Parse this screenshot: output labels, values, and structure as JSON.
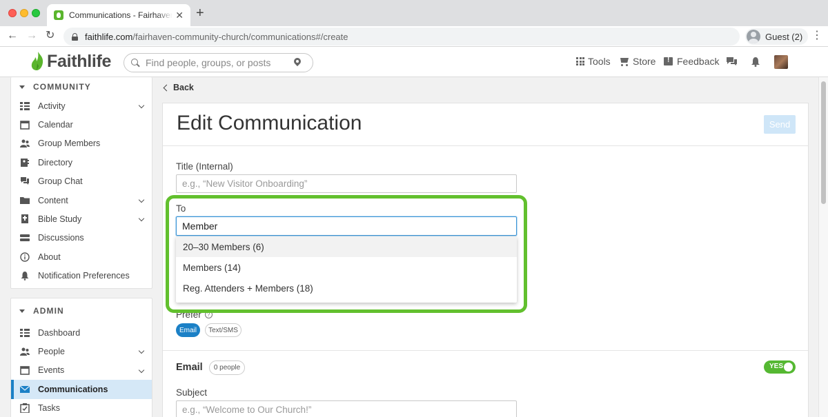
{
  "browser": {
    "tab_title": "Communications - Fairhaven C",
    "url_host": "faithlife.com",
    "url_path": "/fairhaven-community-church/communications#/create",
    "profile_label": "Guest (2)"
  },
  "header": {
    "logo_text": "Faithlife",
    "search_placeholder": "Find people, groups, or posts",
    "menu": {
      "tools": "Tools",
      "store": "Store",
      "feedback": "Feedback"
    }
  },
  "sidebar": {
    "community_title": "COMMUNITY",
    "community_items": [
      {
        "label": "Activity",
        "icon": "activity-icon",
        "expandable": true
      },
      {
        "label": "Calendar",
        "icon": "calendar-icon",
        "expandable": false
      },
      {
        "label": "Group Members",
        "icon": "group-members-icon",
        "expandable": false
      },
      {
        "label": "Directory",
        "icon": "directory-icon",
        "expandable": false
      },
      {
        "label": "Group Chat",
        "icon": "chat-icon",
        "expandable": false
      },
      {
        "label": "Content",
        "icon": "folder-icon",
        "expandable": true
      },
      {
        "label": "Bible Study",
        "icon": "bible-icon",
        "expandable": true
      },
      {
        "label": "Discussions",
        "icon": "discussions-icon",
        "expandable": false
      },
      {
        "label": "About",
        "icon": "info-icon",
        "expandable": false
      },
      {
        "label": "Notification Preferences",
        "icon": "bell-icon",
        "expandable": false
      }
    ],
    "admin_title": "ADMIN",
    "admin_items": [
      {
        "label": "Dashboard",
        "icon": "dashboard-icon",
        "expandable": false
      },
      {
        "label": "People",
        "icon": "people-icon",
        "expandable": true
      },
      {
        "label": "Events",
        "icon": "calendar-icon",
        "expandable": true
      },
      {
        "label": "Communications",
        "icon": "envelope-icon",
        "expandable": false,
        "active": true
      },
      {
        "label": "Tasks",
        "icon": "tasks-icon",
        "expandable": false
      }
    ]
  },
  "main": {
    "back_label": "Back",
    "title": "Edit Communication",
    "send_label": "Send",
    "title_field": {
      "label": "Title (Internal)",
      "placeholder": "e.g., “New Visitor Onboarding”"
    },
    "to_field": {
      "label": "To",
      "value": "Member"
    },
    "suggestions": [
      "20–30 Members (6)",
      "Members (14)",
      "Reg. Attenders + Members (18)"
    ],
    "prefer": {
      "label": "Prefer",
      "options": [
        "Email",
        "Text/SMS"
      ],
      "selected": "Email"
    },
    "email": {
      "heading": "Email",
      "people_badge": "0 people",
      "toggle_label": "YES",
      "toggle_on": true,
      "subject_label": "Subject",
      "subject_placeholder": "e.g., “Welcome to Our Church!”"
    }
  },
  "colors": {
    "brand_green": "#5ab52d",
    "accent_blue": "#1b80c6",
    "highlight_frame": "#62c02e",
    "active_bg": "#d5e8f7"
  }
}
